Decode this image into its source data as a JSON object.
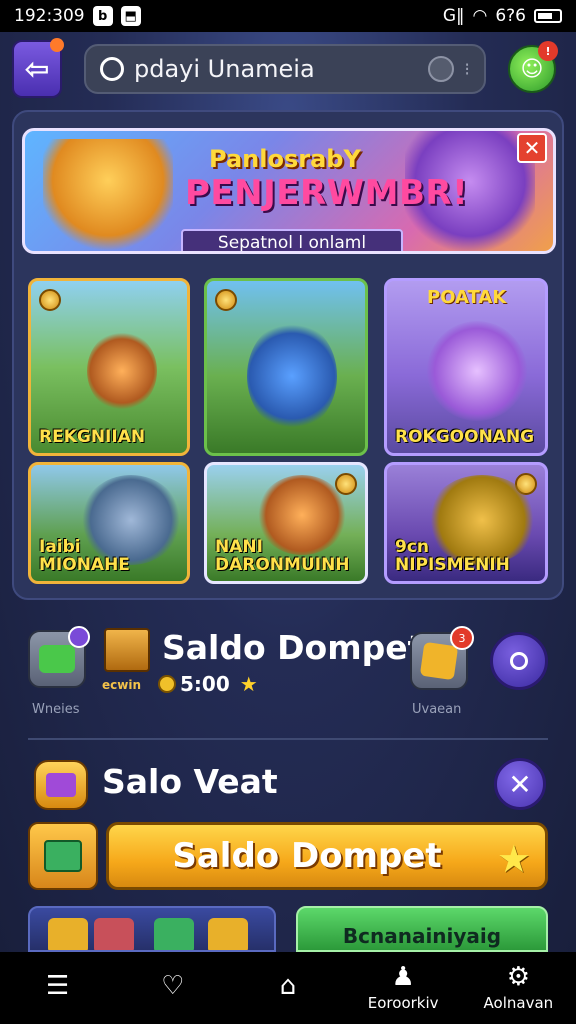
{
  "status_bar": {
    "time": "192:309",
    "battery_text": "6?6"
  },
  "search": {
    "value": "pdayi Unameia"
  },
  "banner": {
    "title_line1": "PanlosrabY",
    "title_line2": "PENJERWMBR!",
    "subtitle": "Sepatnol l onlaml"
  },
  "games": [
    {
      "label": "REKGNIIAN"
    },
    {
      "label": ""
    },
    {
      "label": "ROKGOONANG",
      "badge": "POATAK"
    },
    {
      "label": "Iaibi\nMIONAHE"
    },
    {
      "label": "NANI\nDARONMUINH"
    },
    {
      "label": "9cn\nNIPISMENIH"
    }
  ],
  "wallet": {
    "title": "Saldo Dompet",
    "crate_label": "ecwin",
    "coin_value": "5:00",
    "left_label": "Wneies",
    "gift_badge": "3",
    "right_label": "Uvaean"
  },
  "section2": {
    "title": "Salo Veat",
    "main_button_label": "Saldo Dompet",
    "secondary_button_label": "Bcnanainiyaig"
  },
  "bottom_nav": [
    {
      "icon": "list-icon",
      "glyph": "☰",
      "label": ""
    },
    {
      "icon": "shield-icon",
      "glyph": "♡",
      "label": ""
    },
    {
      "icon": "home-icon",
      "glyph": "⌂",
      "label": ""
    },
    {
      "icon": "user-icon",
      "glyph": "♟",
      "label": "Eoroorkiv"
    },
    {
      "icon": "gear-icon",
      "glyph": "⚙",
      "label": "Aolnavan"
    }
  ],
  "colors": {
    "background": "#1c2240",
    "accent_orange": "#f6a81a",
    "accent_purple": "#4a34b0",
    "accent_green": "#2c9a3a",
    "alert_red": "#e4412f"
  }
}
